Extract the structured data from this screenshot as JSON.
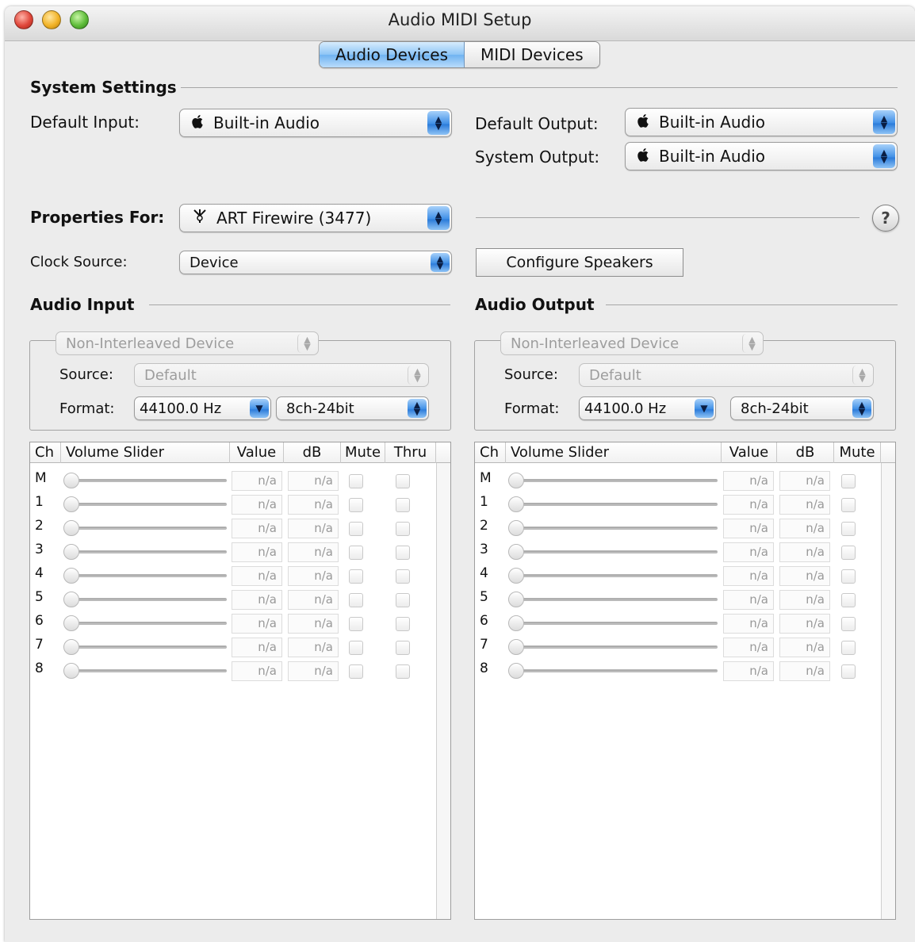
{
  "window": {
    "title": "Audio MIDI Setup"
  },
  "tabs": [
    {
      "label": "Audio Devices",
      "active": true
    },
    {
      "label": "MIDI Devices",
      "active": false
    }
  ],
  "system_settings": {
    "heading": "System Settings",
    "default_input": {
      "label": "Default Input:",
      "value": "Built-in Audio",
      "icon": "apple-icon"
    },
    "default_output": {
      "label": "Default Output:",
      "value": "Built-in Audio",
      "icon": "apple-icon"
    },
    "system_output": {
      "label": "System Output:",
      "value": "Built-in Audio",
      "icon": "apple-icon"
    }
  },
  "properties": {
    "label": "Properties For:",
    "device": "ART Firewire (3477)",
    "device_icon": "firewire-icon",
    "clock_source_label": "Clock Source:",
    "clock_source": "Device",
    "configure_speakers": "Configure Speakers",
    "help": "?"
  },
  "audio_input": {
    "heading": "Audio Input",
    "stream": "Non-Interleaved Device",
    "source_label": "Source:",
    "source": "Default",
    "format_label": "Format:",
    "rate": "44100.0 Hz",
    "bits": "8ch-24bit",
    "columns": [
      "Ch",
      "Volume Slider",
      "Value",
      "dB",
      "Mute",
      "Thru"
    ],
    "channels": [
      {
        "ch": "M",
        "value": "n/a",
        "db": "n/a"
      },
      {
        "ch": "1",
        "value": "n/a",
        "db": "n/a"
      },
      {
        "ch": "2",
        "value": "n/a",
        "db": "n/a"
      },
      {
        "ch": "3",
        "value": "n/a",
        "db": "n/a"
      },
      {
        "ch": "4",
        "value": "n/a",
        "db": "n/a"
      },
      {
        "ch": "5",
        "value": "n/a",
        "db": "n/a"
      },
      {
        "ch": "6",
        "value": "n/a",
        "db": "n/a"
      },
      {
        "ch": "7",
        "value": "n/a",
        "db": "n/a"
      },
      {
        "ch": "8",
        "value": "n/a",
        "db": "n/a"
      }
    ]
  },
  "audio_output": {
    "heading": "Audio Output",
    "stream": "Non-Interleaved Device",
    "source_label": "Source:",
    "source": "Default",
    "format_label": "Format:",
    "rate": "44100.0 Hz",
    "bits": "8ch-24bit",
    "columns": [
      "Ch",
      "Volume Slider",
      "Value",
      "dB",
      "Mute"
    ],
    "channels": [
      {
        "ch": "M",
        "value": "n/a",
        "db": "n/a"
      },
      {
        "ch": "1",
        "value": "n/a",
        "db": "n/a"
      },
      {
        "ch": "2",
        "value": "n/a",
        "db": "n/a"
      },
      {
        "ch": "3",
        "value": "n/a",
        "db": "n/a"
      },
      {
        "ch": "4",
        "value": "n/a",
        "db": "n/a"
      },
      {
        "ch": "5",
        "value": "n/a",
        "db": "n/a"
      },
      {
        "ch": "6",
        "value": "n/a",
        "db": "n/a"
      },
      {
        "ch": "7",
        "value": "n/a",
        "db": "n/a"
      },
      {
        "ch": "8",
        "value": "n/a",
        "db": "n/a"
      }
    ]
  }
}
